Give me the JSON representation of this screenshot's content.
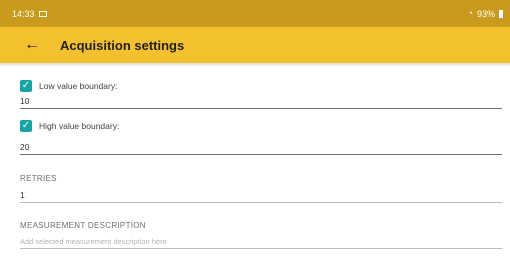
{
  "status_bar": {
    "time": "14:33",
    "battery": "93%"
  },
  "header": {
    "title": "Acquisition settings"
  },
  "settings": {
    "low_boundary": {
      "label": "Low value boundary:",
      "value": "10",
      "checked": true
    },
    "high_boundary": {
      "label": "High value boundary:",
      "value": "20",
      "checked": true
    },
    "retries": {
      "label": "RETRIES",
      "value": "1"
    },
    "measurement_description": {
      "label": "MEASUREMENT DESCRIPTION",
      "placeholder": "Add selected measurement description here"
    }
  },
  "colors": {
    "status_bar": "#c99a1c",
    "app_bar": "#f3c12e",
    "checkbox": "#16a4a8"
  },
  "icons": {
    "back": "arrow-left-icon",
    "check": "check-icon",
    "wifi": "wifi-icon",
    "battery": "battery-icon"
  }
}
